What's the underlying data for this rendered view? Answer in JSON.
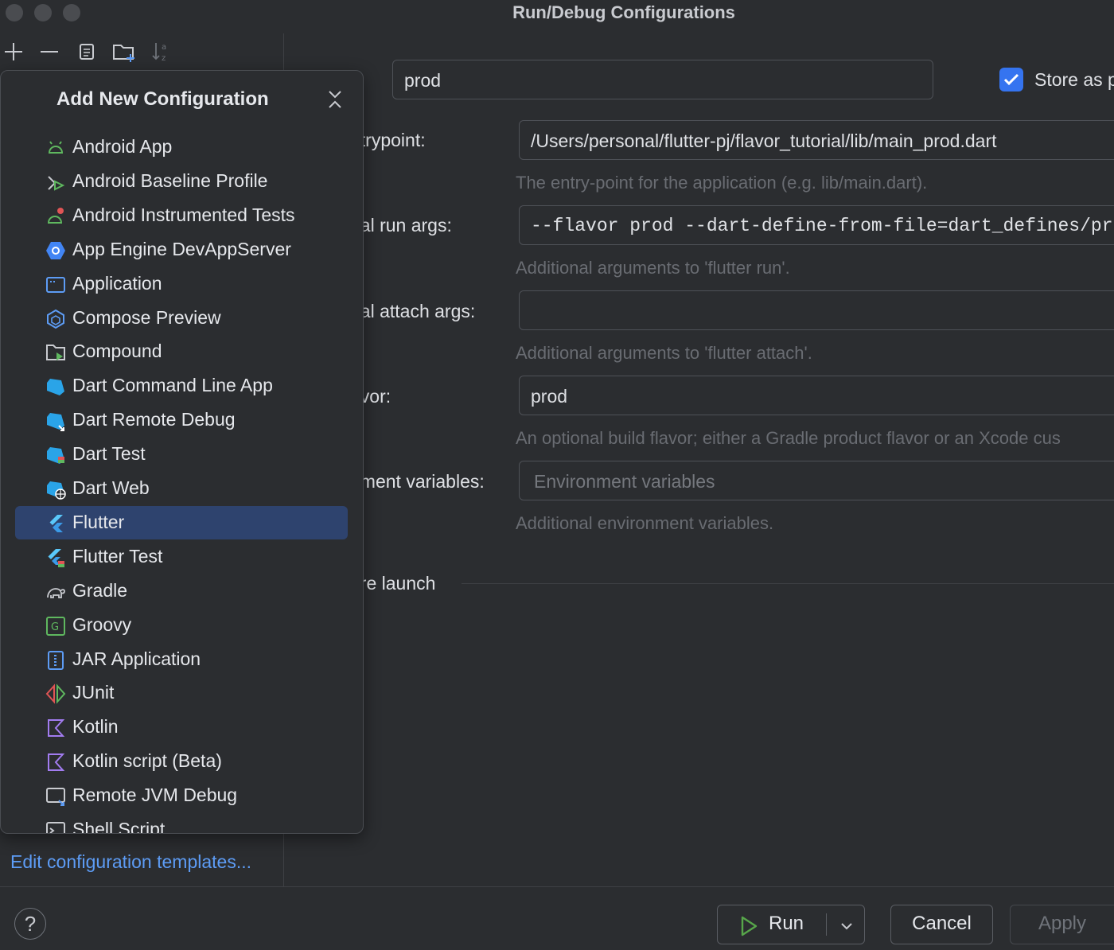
{
  "window": {
    "title": "Run/Debug Configurations"
  },
  "toolbar": {
    "icons": [
      "add-icon",
      "remove-icon",
      "copy-icon",
      "new-folder-icon",
      "sort-icon"
    ]
  },
  "form": {
    "name_value": "prod",
    "store_as_label": "Store as p",
    "store_as_checked": true,
    "entrypoint_label": "ntrypoint:",
    "entrypoint_value": "/Users/personal/flutter-pj/flavor_tutorial/lib/main_prod.dart",
    "entrypoint_hint": "The entry-point for the application (e.g. lib/main.dart).",
    "run_args_label": "nal run args:",
    "run_args_value": "--flavor prod --dart-define-from-file=dart_defines/pr",
    "run_args_hint": "Additional arguments to 'flutter run'.",
    "attach_args_label": "nal attach args:",
    "attach_args_value": "",
    "attach_args_hint": "Additional arguments to 'flutter attach'.",
    "flavor_label": "avor:",
    "flavor_value": "prod",
    "flavor_hint": "An optional build flavor; either a Gradle product flavor or an Xcode cus",
    "env_label": "nment variables:",
    "env_placeholder": "Environment variables",
    "env_hint": "Additional environment variables.",
    "before_launch_label": "ore launch"
  },
  "popup": {
    "title": "Add New Configuration",
    "selected": "Flutter",
    "items": [
      {
        "label": "Android App",
        "icon": "android-icon"
      },
      {
        "label": "Android Baseline Profile",
        "icon": "android-baseline-profile-icon"
      },
      {
        "label": "Android Instrumented Tests",
        "icon": "android-tests-icon"
      },
      {
        "label": "App Engine DevAppServer",
        "icon": "app-engine-icon"
      },
      {
        "label": "Application",
        "icon": "application-icon"
      },
      {
        "label": "Compose Preview",
        "icon": "compose-preview-icon"
      },
      {
        "label": "Compound",
        "icon": "compound-icon"
      },
      {
        "label": "Dart Command Line App",
        "icon": "dart-icon"
      },
      {
        "label": "Dart Remote Debug",
        "icon": "dart-remote-debug-icon"
      },
      {
        "label": "Dart Test",
        "icon": "dart-test-icon"
      },
      {
        "label": "Dart Web",
        "icon": "dart-web-icon"
      },
      {
        "label": "Flutter",
        "icon": "flutter-icon"
      },
      {
        "label": "Flutter Test",
        "icon": "flutter-test-icon"
      },
      {
        "label": "Gradle",
        "icon": "gradle-icon"
      },
      {
        "label": "Groovy",
        "icon": "groovy-icon"
      },
      {
        "label": "JAR Application",
        "icon": "jar-icon"
      },
      {
        "label": "JUnit",
        "icon": "junit-icon"
      },
      {
        "label": "Kotlin",
        "icon": "kotlin-icon"
      },
      {
        "label": "Kotlin script (Beta)",
        "icon": "kotlin-script-icon"
      },
      {
        "label": "Remote JVM Debug",
        "icon": "remote-jvm-debug-icon"
      },
      {
        "label": "Shell Script",
        "icon": "shell-script-icon"
      }
    ]
  },
  "footer": {
    "edit_templates": "Edit configuration templates...",
    "help_label": "?",
    "run_label": "Run",
    "cancel_label": "Cancel",
    "apply_label": "Apply"
  },
  "colors": {
    "background": "#2b2d30",
    "selection": "#2e436e",
    "link": "#5d9cf5",
    "checkbox": "#3574f0",
    "run_green": "#57a64a"
  }
}
